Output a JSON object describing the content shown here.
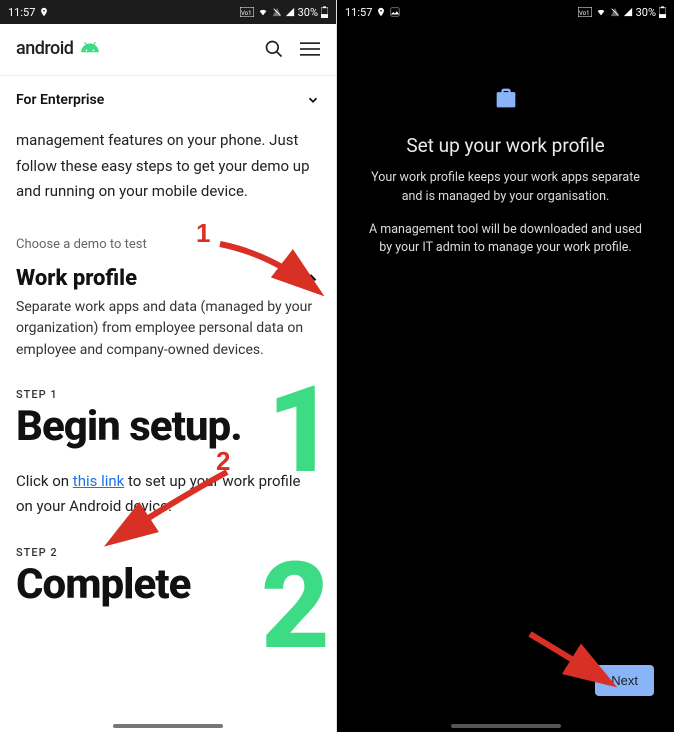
{
  "status": {
    "time": "11:57",
    "battery": "30%"
  },
  "left": {
    "brand": "android",
    "enterprise": "For Enterprise",
    "intro": "management features on your phone. Just follow these easy steps to get your demo up and running on your mobile device.",
    "choose": "Choose a demo to test",
    "accordion_title": "Work profile",
    "accordion_desc": "Separate work apps and data (managed by your organization) from employee personal data on employee and company-owned devices.",
    "step1_label": "STEP 1",
    "step1_title": "Begin setup.",
    "step1_prefix": "Click on ",
    "step1_link": "this link",
    "step1_suffix": " to set up your work profile on your Android device.",
    "step2_label": "STEP 2",
    "step2_title": "Complete"
  },
  "right": {
    "title": "Set up your work profile",
    "sub1": "Your work profile keeps your work apps separate and is managed by your organisation.",
    "sub2": "A management tool will be downloaded and used by your IT admin to manage your work profile.",
    "next": "Next"
  },
  "annotations": {
    "one": "1",
    "two": "2"
  }
}
